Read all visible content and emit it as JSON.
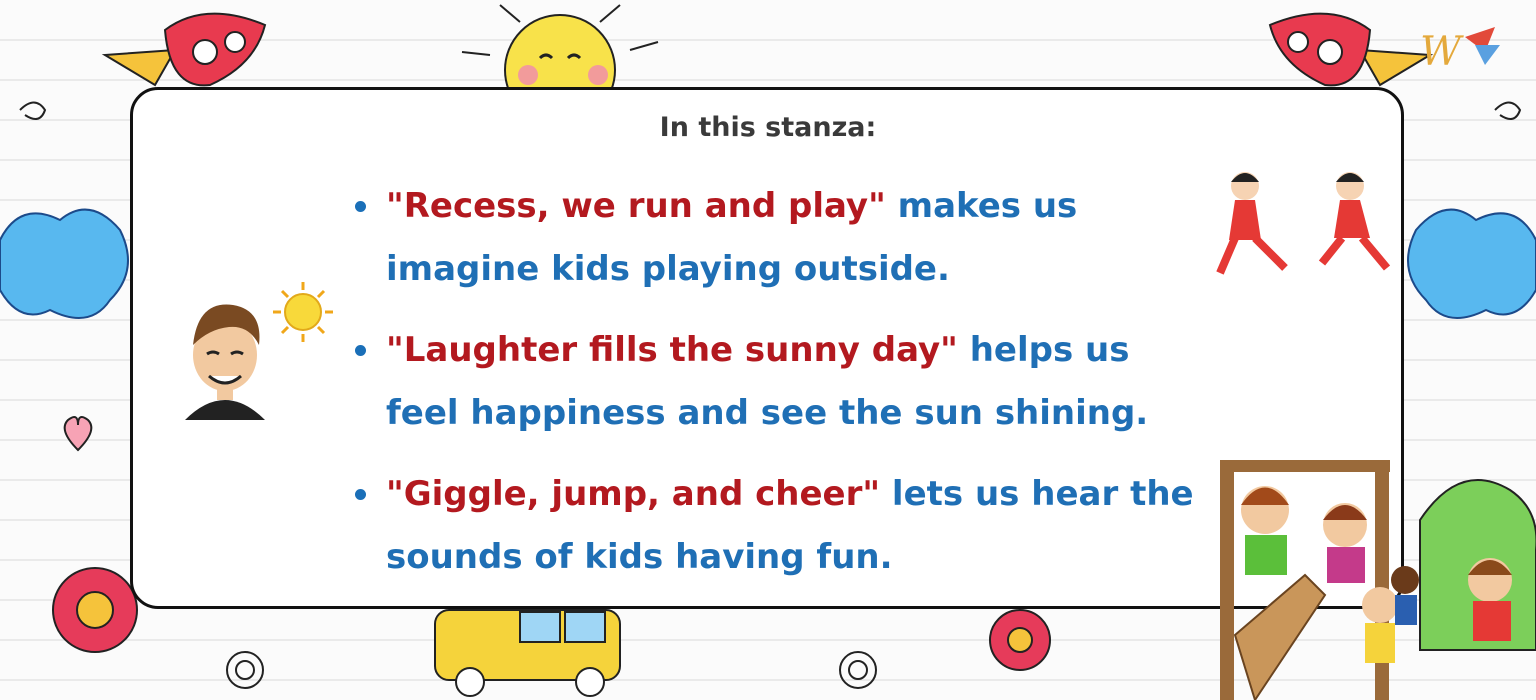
{
  "heading": "In this stanza:",
  "points": [
    {
      "quote": "\"Recess, we run and play\"",
      "text": " makes us imagine kids playing outside."
    },
    {
      "quote": "\"Laughter fills the sunny day\"",
      "text": " helps us feel happiness and see the sun shining."
    },
    {
      "quote": "\"Giggle, jump, and cheer\"",
      "text": " lets us hear the sounds of kids having fun."
    }
  ],
  "logo_letter": "W",
  "colors": {
    "quote": "#b3191f",
    "description": "#1f6fb5",
    "bullet": "#1a6fb8",
    "card_border": "#111111",
    "heading": "#3a3a3a"
  },
  "icons": [
    "sun-icon",
    "rocket-icon",
    "cloud-icon",
    "flower-icon",
    "heart-icon",
    "school-bus-icon",
    "boy-avatar-icon",
    "running-girls-icon",
    "playground-kids-icon",
    "brand-logo-icon"
  ]
}
